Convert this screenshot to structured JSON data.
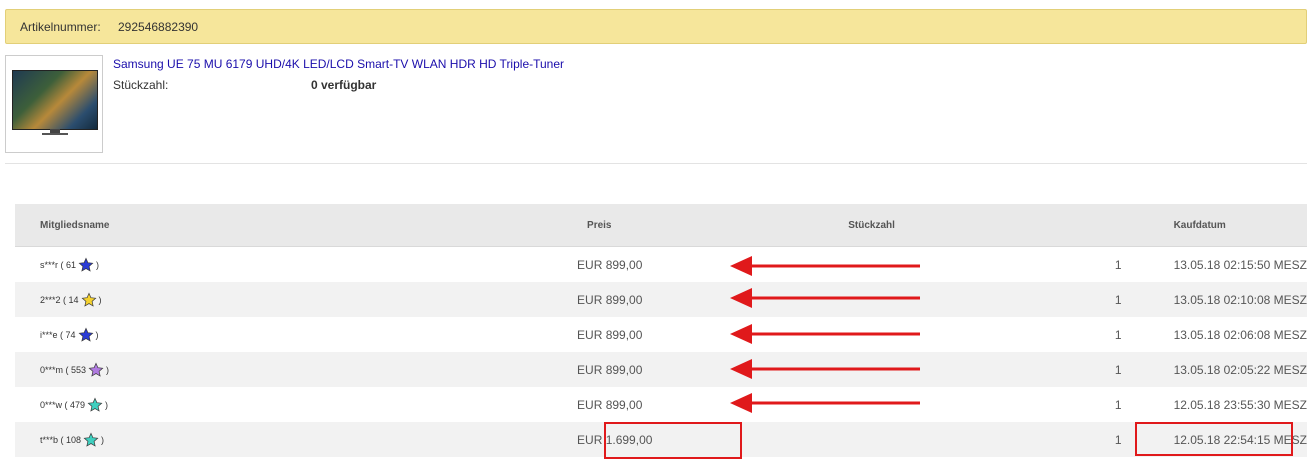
{
  "article": {
    "label": "Artikelnummer:",
    "number": "292546882390"
  },
  "product": {
    "title": "Samsung UE 75 MU 6179 UHD/4K LED/LCD Smart-TV WLAN HDR HD Triple-Tuner",
    "qty_label": "Stückzahl:",
    "qty_value": "0 verfügbar"
  },
  "table": {
    "headers": {
      "member": "Mitgliedsname",
      "price": "Preis",
      "qty": "Stückzahl",
      "date": "Kaufdatum"
    },
    "rows": [
      {
        "member": "s***r ( 61",
        "member_close": ")",
        "star_color": "#2a3bd6",
        "price": "EUR 899,00",
        "qty": "1",
        "date": "13.05.18 02:15:50 MESZ"
      },
      {
        "member": "2***2 ( 14",
        "member_close": ")",
        "star_color": "#f5d22f",
        "price": "EUR 899,00",
        "qty": "1",
        "date": "13.05.18 02:10:08 MESZ"
      },
      {
        "member": "i***e ( 74",
        "member_close": ")",
        "star_color": "#2a3bd6",
        "price": "EUR 899,00",
        "qty": "1",
        "date": "13.05.18 02:06:08 MESZ"
      },
      {
        "member": "0***m ( 553",
        "member_close": ")",
        "star_color": "#b07be0",
        "price": "EUR 899,00",
        "qty": "1",
        "date": "13.05.18 02:05:22 MESZ"
      },
      {
        "member": "0***w ( 479",
        "member_close": ")",
        "star_color": "#3fd0c0",
        "price": "EUR 899,00",
        "qty": "1",
        "date": "12.05.18 23:55:30 MESZ"
      },
      {
        "member": "t***b ( 108",
        "member_close": ")",
        "star_color": "#3fd0c0",
        "price": "EUR 1.699,00",
        "qty": "1",
        "date": "12.05.18 22:54:15 MESZ"
      }
    ]
  },
  "annotation_color": "#e0191b"
}
